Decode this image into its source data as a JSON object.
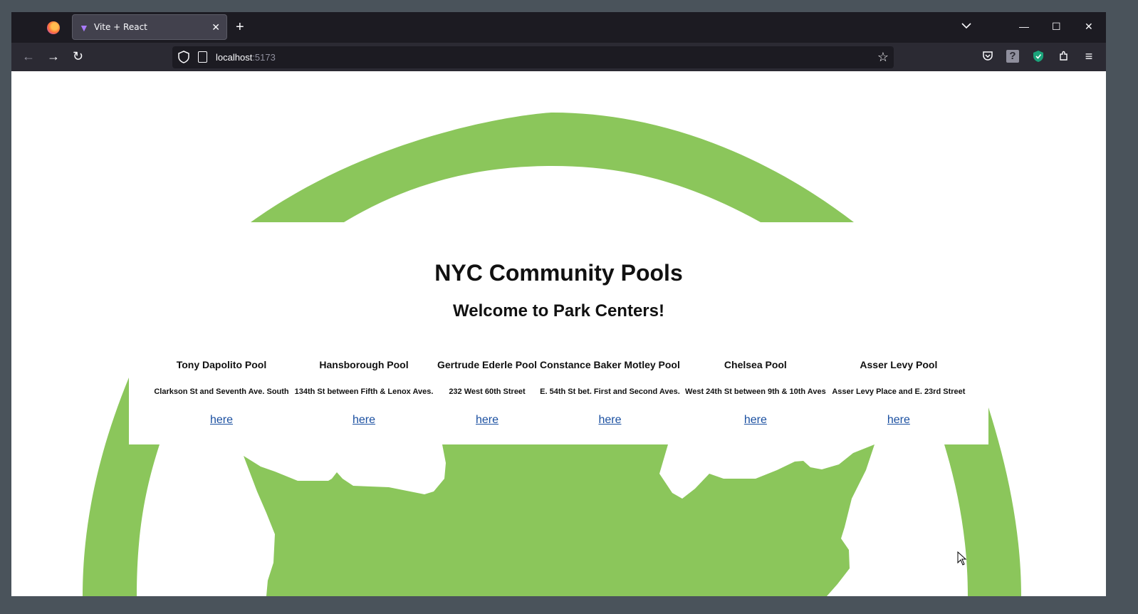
{
  "browser": {
    "tab_title": "Vite + React",
    "tab_close": "✕",
    "new_tab": "+",
    "tab_list": "⌄",
    "window_controls": {
      "minimize": "—",
      "maximize": "☐",
      "close": "✕"
    },
    "url_host": "localhost",
    "url_port": ":5173",
    "nav": {
      "back": "←",
      "forward": "→",
      "reload": "↻"
    },
    "bookmark_star": "☆",
    "menu": "≡",
    "icons": [
      "pocket-icon",
      "help-icon",
      "shield-extension-icon",
      "extensions-icon",
      "menu-icon"
    ]
  },
  "page": {
    "title": "NYC Community Pools",
    "subtitle": "Welcome to Park Centers!",
    "accent_color": "#8bc65b",
    "pools": [
      {
        "name": "Tony Dapolito Pool",
        "address": "Clarkson St and Seventh Ave. South",
        "link": "here"
      },
      {
        "name": "Hansborough Pool",
        "address": "134th St between Fifth & Lenox Aves.",
        "link": "here"
      },
      {
        "name": "Gertrude Ederle Pool",
        "address": "232 West 60th Street",
        "link": "here"
      },
      {
        "name": "Constance Baker Motley Pool",
        "address": "E. 54th St bet. First and Second Aves.",
        "link": "here"
      },
      {
        "name": "Chelsea Pool",
        "address": "West 24th St between 9th & 10th Aves",
        "link": "here"
      },
      {
        "name": "Asser Levy Pool",
        "address": "Asser Levy Place and E. 23rd Street",
        "link": "here"
      }
    ]
  }
}
